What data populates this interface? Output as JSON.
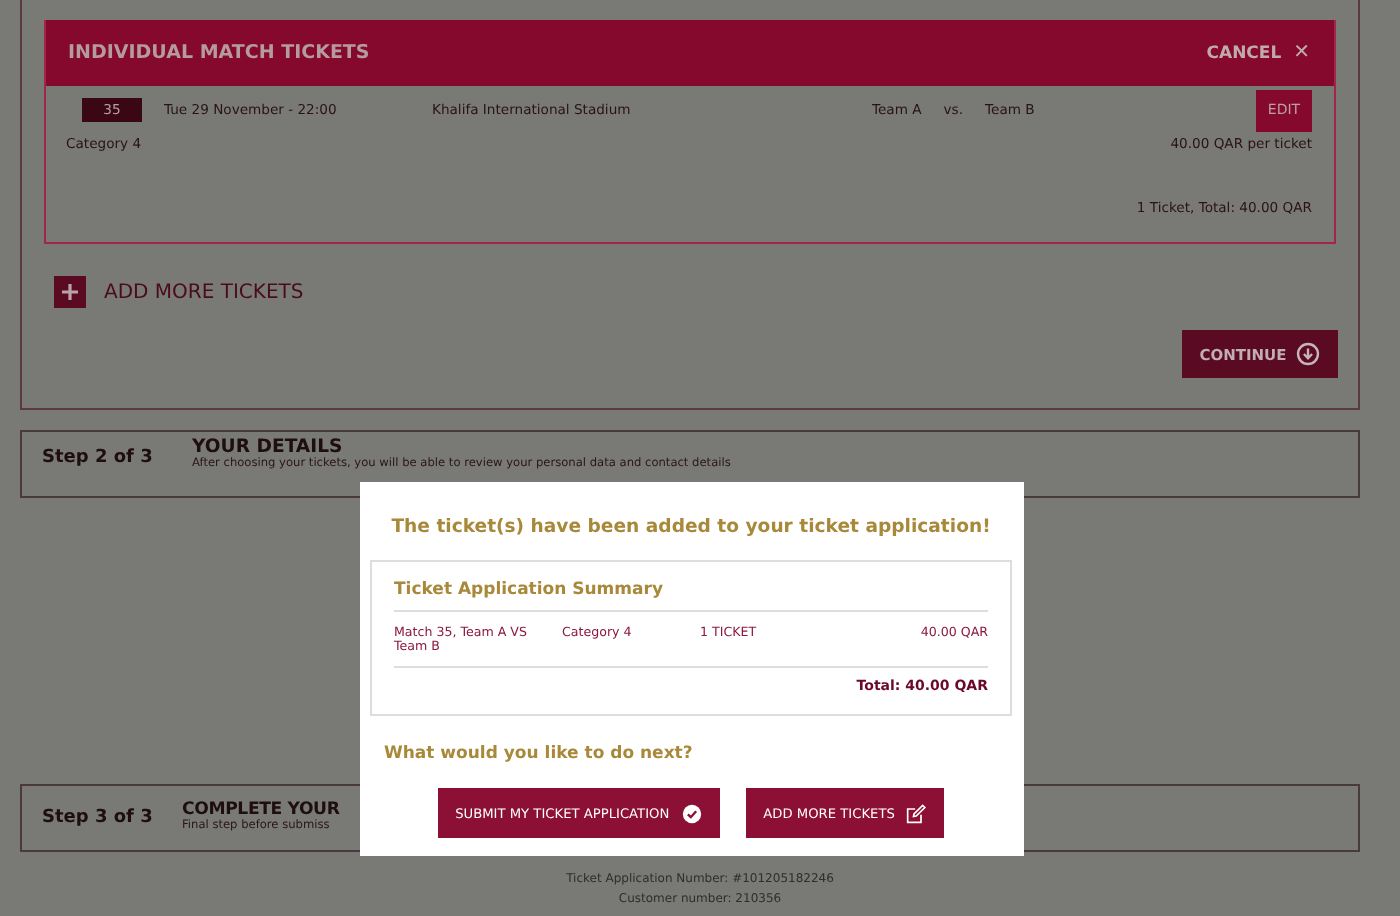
{
  "tickets_panel": {
    "title": "INDIVIDUAL MATCH TICKETS",
    "cancel": "CANCEL",
    "cancel_icon": "✕",
    "ticket": {
      "match_number": "35",
      "date": "Tue 29 November - 22:00",
      "stadium": "Khalifa International Stadium",
      "team_a": "Team A",
      "vs": "vs.",
      "team_b": "Team B",
      "edit": "EDIT",
      "category": "Category 4",
      "price": "40.00 QAR per ticket",
      "total": "1 Ticket, Total: 40.00 QAR"
    },
    "add_more": "ADD MORE TICKETS",
    "continue": "CONTINUE"
  },
  "steps": [
    {
      "step": "Step 2 of 3",
      "title": "YOUR DETAILS",
      "subtitle": "After choosing your tickets, you will be able to review your personal data and contact details"
    },
    {
      "step": "Step 3 of 3",
      "title": "COMPLETE YOUR",
      "subtitle": "Final step before submiss"
    }
  ],
  "footer": [
    "Ticket Application Number: #101205182246",
    "Customer number: 210356"
  ],
  "modal": {
    "title": "The ticket(s) have been added to your ticket application!",
    "summary_title": "Ticket Application Summary",
    "rows": [
      {
        "match": "Match 35, Team A VS Team B",
        "category": "Category 4",
        "quantity": "1 TICKET",
        "price": "40.00 QAR"
      }
    ],
    "total": "Total: 40.00 QAR",
    "question": "What would you like to do next?",
    "buttons": [
      {
        "label": "SUBMIT MY TICKET APPLICATION",
        "kind": "check"
      },
      {
        "label": "ADD MORE TICKETS",
        "kind": "edit"
      }
    ]
  }
}
